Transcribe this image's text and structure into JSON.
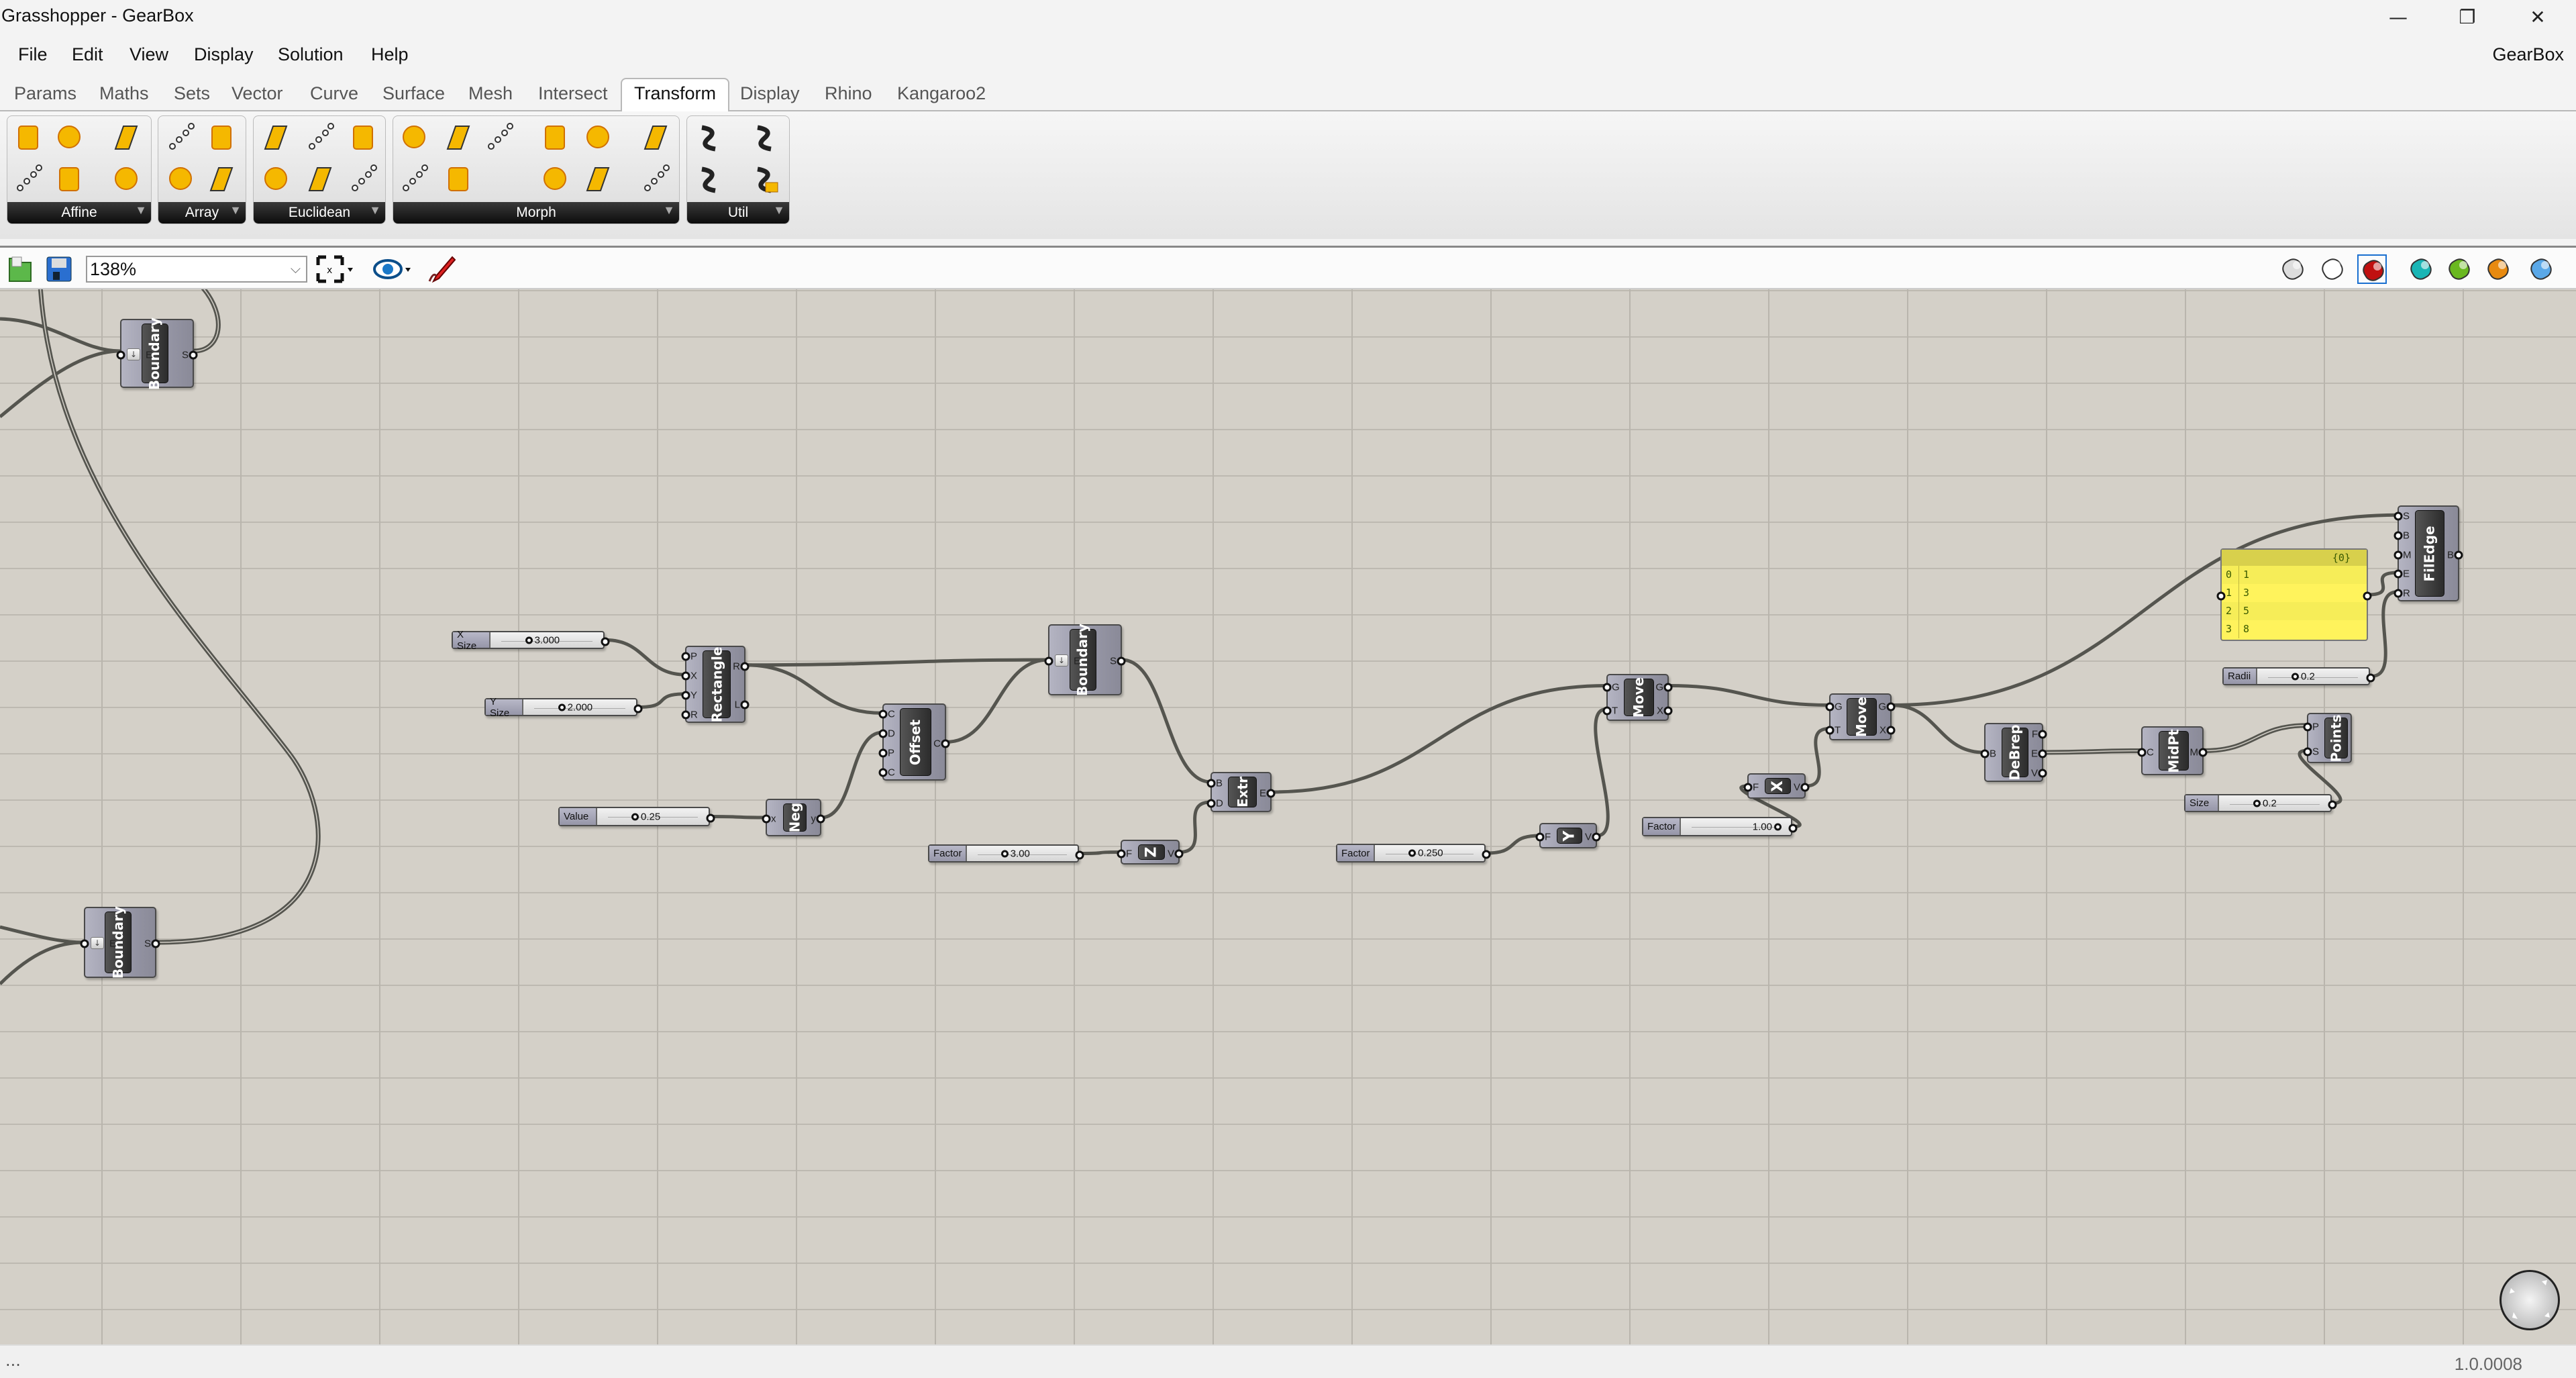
{
  "window": {
    "title": "Grasshopper - GearBox",
    "controls": [
      "minimize-icon",
      "restore-icon",
      "close-icon"
    ],
    "control_glyphs": [
      "—",
      "❐",
      "✕"
    ]
  },
  "menu": {
    "items": [
      "File",
      "Edit",
      "View",
      "Display",
      "Solution",
      "Help"
    ],
    "app_name": "GearBox"
  },
  "tabs": {
    "items": [
      "Params",
      "Maths",
      "Sets",
      "Vector",
      "Curve",
      "Surface",
      "Mesh",
      "Intersect",
      "Transform",
      "Display",
      "Rhino",
      "Kangaroo2"
    ],
    "active": "Transform"
  },
  "ribbon": {
    "groups": [
      {
        "label": "Affine",
        "icons": [
          "scale-icon",
          "shear-icon",
          "project-icon",
          "box-mapping-icon",
          "orient-direction-icon",
          "camera-obscura-icon"
        ]
      },
      {
        "label": "Array",
        "icons": [
          "curve-array-icon",
          "polar-array-icon",
          "linear-array-icon",
          "rectangular-array-icon"
        ]
      },
      {
        "label": "Euclidean",
        "icons": [
          "mirror-icon",
          "orient-icon",
          "rotate-axis-icon",
          "move-icon",
          "rotate-icon",
          "rotate-direction-icon"
        ]
      },
      {
        "label": "Morph",
        "icons": [
          "box-morph-icon",
          "blend-box-icon",
          "surface-box-icon",
          "bend-deform-icon",
          "maelstrom-icon",
          "box-mapping-morph-icon",
          "spatial-deform-icon",
          "surface-morph-icon",
          "stretch-icon",
          "twisted-box-icon",
          "point-deform-icon"
        ]
      },
      {
        "label": "Util",
        "icons": [
          "compound-icon",
          "split-icon",
          "inverse-transform-icon",
          "transform-icon"
        ]
      }
    ],
    "colors": {
      "icon": "#f5b800",
      "icon_dark": "#d07000",
      "label_bar": "#111111"
    }
  },
  "canvas_toolbar": {
    "zoom": "138%",
    "left_icons": [
      "open-file-icon",
      "save-file-icon",
      "zoom-extents-icon",
      "preview-eye-icon",
      "sketch-pen-icon"
    ],
    "right_icons": [
      "preview-off-icon",
      "wireframe-preview-icon",
      "shaded-preview-icon",
      "selected-only-preview-icon",
      "preview-mesh-quality-icon",
      "preview-material-icon",
      "document-preview-icon"
    ],
    "selected_right": "shaded-preview-icon"
  },
  "components": [
    {
      "id": "boundary_top",
      "label": "Boundary",
      "inputs": [
        "E"
      ],
      "outputs": [
        "S"
      ]
    },
    {
      "id": "boundary_bottom",
      "label": "Boundary",
      "inputs": [
        "E"
      ],
      "outputs": [
        "S"
      ]
    },
    {
      "id": "rectangle",
      "label": "Rectangle",
      "inputs": [
        "P",
        "X",
        "Y",
        "R"
      ],
      "outputs": [
        "R",
        "L"
      ]
    },
    {
      "id": "offset",
      "label": "Offset",
      "inputs": [
        "C",
        "D",
        "P",
        "C"
      ],
      "outputs": [
        "C"
      ]
    },
    {
      "id": "boundary_mid",
      "label": "Boundary",
      "inputs": [
        "E"
      ],
      "outputs": [
        "S"
      ]
    },
    {
      "id": "neg",
      "label": "Neg",
      "inputs": [
        "x"
      ],
      "outputs": [
        "y"
      ]
    },
    {
      "id": "unit_z",
      "label": "Z",
      "inputs": [
        "F"
      ],
      "outputs": [
        "V"
      ]
    },
    {
      "id": "extrude",
      "label": "Extr",
      "inputs": [
        "B",
        "D"
      ],
      "outputs": [
        "E"
      ]
    },
    {
      "id": "move1",
      "label": "Move",
      "inputs": [
        "G",
        "T"
      ],
      "outputs": [
        "G",
        "X"
      ]
    },
    {
      "id": "unit_y",
      "label": "Y",
      "inputs": [
        "F"
      ],
      "outputs": [
        "V"
      ]
    },
    {
      "id": "move2",
      "label": "Move",
      "inputs": [
        "G",
        "T"
      ],
      "outputs": [
        "G",
        "X"
      ]
    },
    {
      "id": "unit_x",
      "label": "X",
      "inputs": [
        "F"
      ],
      "outputs": [
        "V"
      ]
    },
    {
      "id": "debrep",
      "label": "DeBrep",
      "inputs": [
        "B"
      ],
      "outputs": [
        "F",
        "E",
        "V"
      ]
    },
    {
      "id": "midpt",
      "label": "MidPt",
      "inputs": [
        "C"
      ],
      "outputs": [
        "M"
      ]
    },
    {
      "id": "points",
      "label": "Points",
      "inputs": [
        "P",
        "S"
      ],
      "outputs": []
    },
    {
      "id": "filedge",
      "label": "FilEdge",
      "inputs": [
        "S",
        "B",
        "M",
        "E",
        "R"
      ],
      "outputs": [
        "B"
      ]
    }
  ],
  "sliders": [
    {
      "id": "xsize",
      "label": "X Size",
      "value": "3.000"
    },
    {
      "id": "ysize",
      "label": "Y Size",
      "value": "2.000"
    },
    {
      "id": "value",
      "label": "Value",
      "value": "0.25"
    },
    {
      "id": "factor_z",
      "label": "Factor",
      "value": "3.00"
    },
    {
      "id": "factor_y",
      "label": "Factor",
      "value": "0.250"
    },
    {
      "id": "factor_x",
      "label": "Factor",
      "value": "1.00"
    },
    {
      "id": "radii",
      "label": "Radii",
      "value": "0.2"
    },
    {
      "id": "size",
      "label": "Size",
      "value": "0.2"
    }
  ],
  "panel": {
    "header": "{0}",
    "rows": [
      [
        "0",
        "1"
      ],
      [
        "1",
        "3"
      ],
      [
        "2",
        "5"
      ],
      [
        "3",
        "8"
      ]
    ]
  },
  "connections": [
    {
      "from": [
        "xsize",
        0
      ],
      "to": [
        "rectangle",
        1
      ]
    },
    {
      "from": [
        "ysize",
        0
      ],
      "to": [
        "rectangle",
        2
      ]
    },
    {
      "from": [
        "rectangle",
        0
      ],
      "to": [
        "boundary_mid",
        0
      ]
    },
    {
      "from": [
        "rectangle",
        0
      ],
      "to": [
        "offset",
        0
      ]
    },
    {
      "from": [
        "value",
        0
      ],
      "to": [
        "neg",
        0
      ]
    },
    {
      "from": [
        "neg",
        0
      ],
      "to": [
        "offset",
        1
      ]
    },
    {
      "from": [
        "offset",
        0
      ],
      "to": [
        "boundary_mid",
        0
      ]
    },
    {
      "from": [
        "boundary_mid",
        0
      ],
      "to": [
        "extrude",
        0
      ]
    },
    {
      "from": [
        "factor_z",
        0
      ],
      "to": [
        "unit_z",
        0
      ]
    },
    {
      "from": [
        "unit_z",
        0
      ],
      "to": [
        "extrude",
        1
      ]
    },
    {
      "from": [
        "extrude",
        0
      ],
      "to": [
        "move1",
        0
      ]
    },
    {
      "from": [
        "factor_y",
        0
      ],
      "to": [
        "unit_y",
        0
      ]
    },
    {
      "from": [
        "unit_y",
        0
      ],
      "to": [
        "move1",
        1
      ]
    },
    {
      "from": [
        "move1",
        0
      ],
      "to": [
        "move2",
        0
      ]
    },
    {
      "from": [
        "factor_x",
        0
      ],
      "to": [
        "unit_x",
        0
      ]
    },
    {
      "from": [
        "unit_x",
        0
      ],
      "to": [
        "move2",
        1
      ]
    },
    {
      "from": [
        "move2",
        0
      ],
      "to": [
        "filedge",
        0
      ]
    },
    {
      "from": [
        "move2",
        0
      ],
      "to": [
        "debrep",
        0
      ]
    },
    {
      "from": [
        "debrep",
        1
      ],
      "to": [
        "midpt",
        0
      ]
    },
    {
      "from": [
        "midpt",
        0
      ],
      "to": [
        "points",
        0
      ]
    },
    {
      "from": [
        "size",
        0
      ],
      "to": [
        "points",
        1
      ]
    },
    {
      "from": [
        "panel",
        0
      ],
      "to": [
        "filedge",
        3
      ]
    },
    {
      "from": [
        "radii",
        0
      ],
      "to": [
        "filedge",
        4
      ]
    }
  ],
  "status": {
    "left": "...",
    "version": "1.0.0008"
  },
  "colors": {
    "canvas": "#d4d0c8",
    "wire": "#55554f",
    "panel": "#fff35c",
    "component": "#9a9aaa"
  }
}
